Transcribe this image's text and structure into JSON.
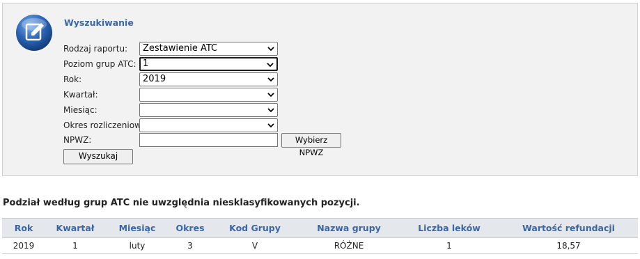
{
  "search": {
    "title": "Wyszukiwanie",
    "fields": [
      {
        "label": "Rodzaj raportu:",
        "value": "Zestawienie ATC"
      },
      {
        "label": "Poziom grup ATC:",
        "value": "1"
      },
      {
        "label": "Rok:",
        "value": "2019"
      },
      {
        "label": "Kwartał:",
        "value": ""
      },
      {
        "label": "Miesiąc:",
        "value": ""
      },
      {
        "label": "Okres rozliczeniowy:",
        "value": ""
      }
    ],
    "npwz_label": "NPWZ:",
    "npwz_value": "",
    "npwz_button": "Wybierz NPWZ",
    "search_button": "Wyszukaj"
  },
  "note": "Podział według grup ATC nie uwzględnia niesklasyfikowanych pozycji.",
  "table": {
    "headers": [
      "Rok",
      "Kwartał",
      "Miesiąc",
      "Okres",
      "Kod Grupy",
      "Nazwa grupy",
      "Liczba leków",
      "Wartość refundacji"
    ],
    "rows": [
      [
        "2019",
        "1",
        "luty",
        "3",
        "V",
        "RÓŻNE",
        "1",
        "18,57"
      ]
    ]
  },
  "colors": {
    "accent": "#3a66a7",
    "panel_bg": "#f2f2f2",
    "header_bg": "#e4e7ec"
  },
  "icons": {
    "panel": "edit-document-icon",
    "dropdown": "chevron-down-icon"
  }
}
